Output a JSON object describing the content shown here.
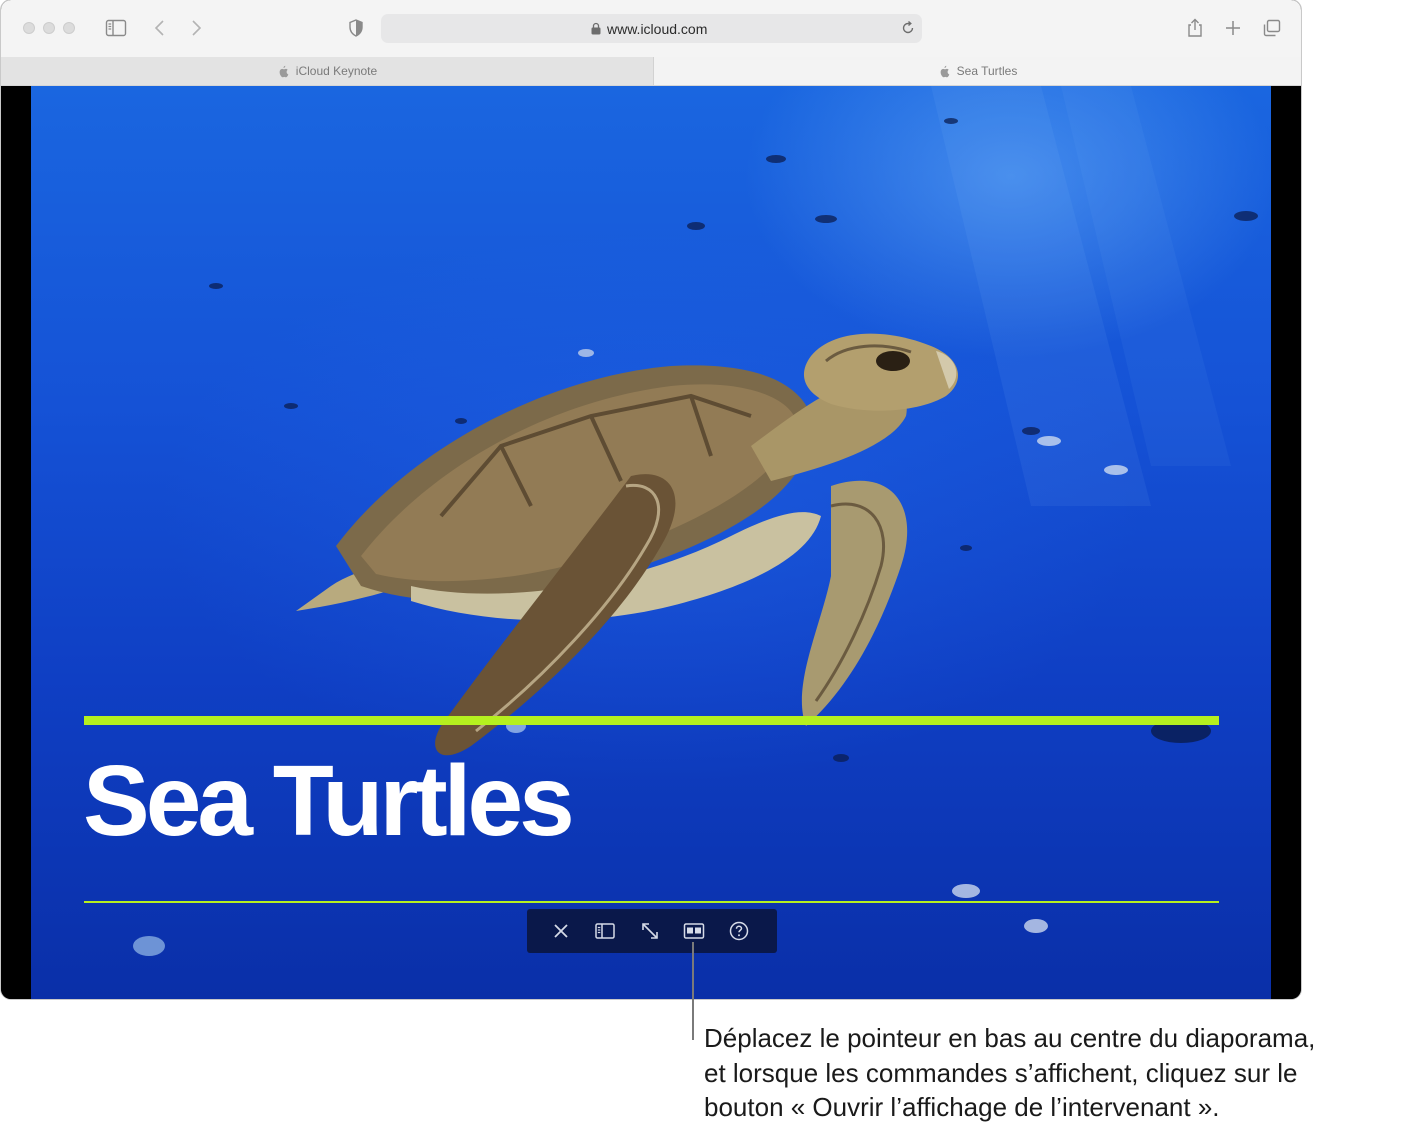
{
  "browser": {
    "address": "www.icloud.com",
    "tabs": [
      {
        "label": "iCloud Keynote",
        "active": false
      },
      {
        "label": "Sea Turtles",
        "active": true
      }
    ],
    "icons": {
      "sidebar": "sidebar-icon",
      "back": "chevron-left-icon",
      "forward": "chevron-right-icon",
      "privacy": "shield-icon",
      "lock": "lock-icon",
      "reload": "reload-icon",
      "share": "share-icon",
      "new_tab": "plus-icon",
      "tab_overview": "tab-overview-icon"
    }
  },
  "slide": {
    "title": "Sea Turtles",
    "accent_color": "#b5f01f"
  },
  "controls": [
    {
      "icon": "close-icon"
    },
    {
      "icon": "sidebar-icon"
    },
    {
      "icon": "fullscreen-icon"
    },
    {
      "icon": "presenter-display-icon"
    },
    {
      "icon": "help-icon"
    }
  ],
  "callout": {
    "lines": [
      "Déplacez le pointeur en bas au centre du diaporama,",
      "et lorsque les commandes s’affichent, cliquez sur le",
      "bouton « Ouvrir l’affichage de l’intervenant »."
    ]
  }
}
